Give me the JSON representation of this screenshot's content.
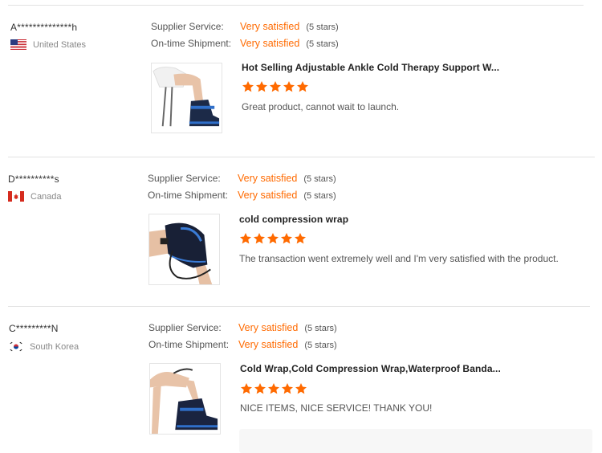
{
  "reviews": [
    {
      "buyer": "A**************h",
      "country": "United States",
      "flag_icon": "us-flag-icon",
      "supplier_label": "Supplier Service:",
      "supplier_value": "Very satisfied",
      "supplier_stars": "(5 stars)",
      "shipment_label": "On-time Shipment:",
      "shipment_value": "Very satisfied",
      "shipment_stars": "(5 stars)",
      "product_title": "Hot Selling Adjustable Ankle Cold Therapy Support W...",
      "rating": 5,
      "feedback": "Great product, cannot wait to launch."
    },
    {
      "buyer": "D**********s",
      "country": "Canada",
      "flag_icon": "canada-flag-icon",
      "supplier_label": "Supplier Service:",
      "supplier_value": "Very satisfied",
      "supplier_stars": "(5 stars)",
      "shipment_label": "On-time Shipment:",
      "shipment_value": "Very satisfied",
      "shipment_stars": "(5 stars)",
      "product_title": "cold compression wrap",
      "rating": 5,
      "feedback": "The transaction went extremely well and I'm very satisfied with the product."
    },
    {
      "buyer": "C*********N",
      "country": "South Korea",
      "flag_icon": "south-korea-flag-icon",
      "supplier_label": "Supplier Service:",
      "supplier_value": "Very satisfied",
      "supplier_stars": "(5 stars)",
      "shipment_label": "On-time Shipment:",
      "shipment_value": "Very satisfied",
      "shipment_stars": "(5 stars)",
      "product_title": "Cold Wrap,Cold Compression Wrap,Waterproof Banda...",
      "rating": 5,
      "feedback": "NICE ITEMS, NICE SERVICE! THANK YOU!"
    }
  ],
  "colors": {
    "accent": "#ff6a00",
    "divider": "#e2e2e2"
  }
}
